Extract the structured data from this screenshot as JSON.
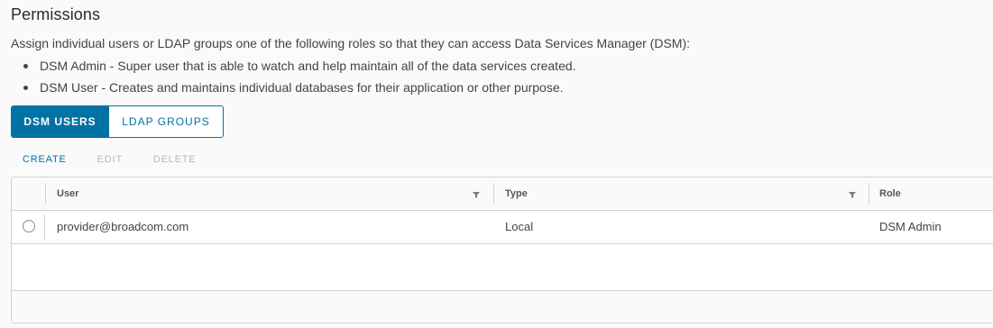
{
  "page": {
    "title": "Permissions",
    "description": "Assign individual users or LDAP groups one of the following roles so that they can access Data Services Manager (DSM):",
    "bullets": [
      "DSM Admin - Super user that is able to watch and help maintain all of the data services created.",
      "DSM User - Creates and maintains individual databases for their application or other purpose."
    ]
  },
  "tabs": {
    "items": [
      {
        "label": "DSM USERS",
        "active": true
      },
      {
        "label": "LDAP GROUPS",
        "active": false
      }
    ]
  },
  "actions": {
    "create": "CREATE",
    "edit": "EDIT",
    "delete": "DELETE"
  },
  "grid": {
    "columns": [
      "User",
      "Type",
      "Role"
    ],
    "rows": [
      {
        "user": "provider@broadcom.com",
        "type": "Local",
        "role": "DSM Admin"
      }
    ]
  },
  "icons": {
    "filter": "filter-icon",
    "radio": "radio-button"
  },
  "colors": {
    "accent": "#0072a3",
    "disabled": "#b7b7b7",
    "border": "#d2d2d2"
  }
}
